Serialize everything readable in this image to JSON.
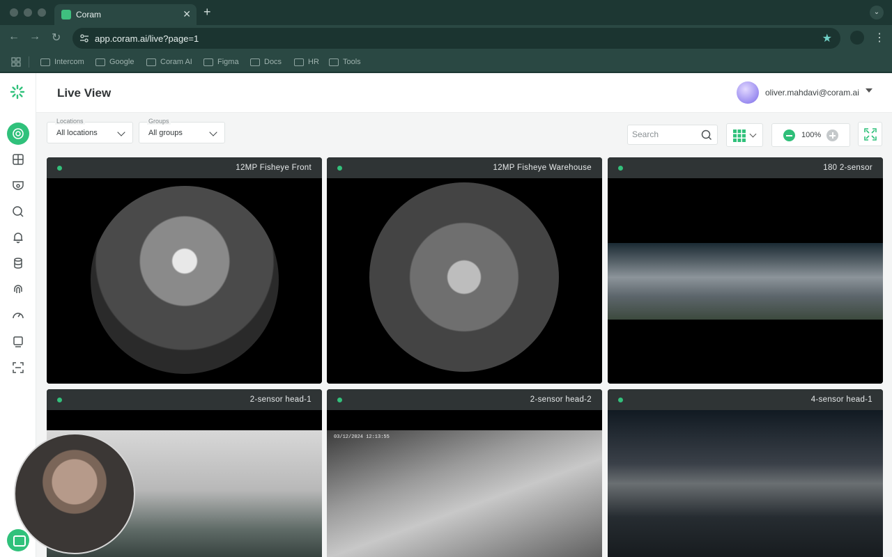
{
  "browser": {
    "tab_title": "Coram",
    "url": "app.coram.ai/live?page=1",
    "bookmarks": [
      "Intercom",
      "Google",
      "Coram AI",
      "Figma",
      "Docs",
      "HR",
      "Tools"
    ]
  },
  "app": {
    "title": "Live View",
    "user_email": "oliver.mahdavi@coram.ai",
    "filters": {
      "locations": {
        "label": "Locations",
        "value": "All locations"
      },
      "groups": {
        "label": "Groups",
        "value": "All groups"
      }
    },
    "search_placeholder": "Search",
    "zoom": "100%",
    "cameras": [
      {
        "name": "12MP Fisheye Front",
        "status": "online"
      },
      {
        "name": "12MP Fisheye Warehouse",
        "status": "online"
      },
      {
        "name": "180 2-sensor",
        "status": "online"
      },
      {
        "name": "2-sensor head-1",
        "status": "online"
      },
      {
        "name": "2-sensor head-2",
        "status": "online"
      },
      {
        "name": "4-sensor head-1",
        "status": "online"
      }
    ],
    "feed_timestamp": "03/12/2024 12:13:55",
    "colors": {
      "accent": "#30c17b",
      "chrome": "#2a4843"
    }
  }
}
